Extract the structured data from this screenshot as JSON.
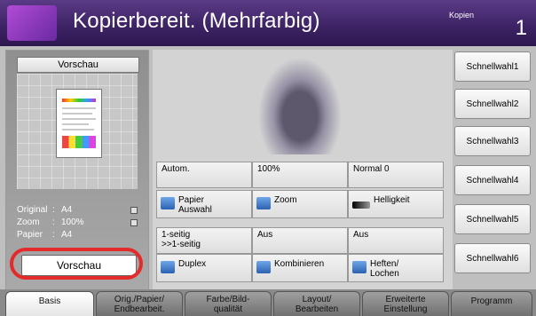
{
  "header": {
    "title": "Kopierbereit. (Mehrfarbig)",
    "copies_label": "Kopien",
    "copies_value": "1"
  },
  "left_panel": {
    "preview_header": "Vorschau",
    "info": [
      {
        "label": "Original",
        "value": "A4"
      },
      {
        "label": "Zoom",
        "value": "100%"
      },
      {
        "label": "Papier",
        "value": "A4"
      }
    ],
    "preview_button": "Vorschau"
  },
  "settings": {
    "values_row1": [
      "Autom.",
      "100%",
      "Normal 0"
    ],
    "buttons_row1": [
      {
        "label": "Papier\nAuswahl",
        "icon": "paper-icon"
      },
      {
        "label": "Zoom",
        "icon": "zoom-icon"
      },
      {
        "label": "Helligkeit",
        "icon": "density-icon"
      }
    ],
    "values_row2": [
      "1-seitig\n>>1-seitig",
      "Aus",
      "Aus"
    ],
    "buttons_row2": [
      {
        "label": "Duplex",
        "icon": "duplex-icon"
      },
      {
        "label": "Kombinieren",
        "icon": "combine-icon"
      },
      {
        "label": "Heften/\nLochen",
        "icon": "staple-icon"
      }
    ]
  },
  "quick_buttons": [
    "Schnellwahl1",
    "Schnellwahl2",
    "Schnellwahl3",
    "Schnellwahl4",
    "Schnellwahl5",
    "Schnellwahl6"
  ],
  "tabs": [
    {
      "label": "Basis",
      "active": true
    },
    {
      "label": "Orig./Papier/\nEndbearbeit."
    },
    {
      "label": "Farbe/Bild-\nqualität"
    },
    {
      "label": "Layout/\nBearbeiten"
    },
    {
      "label": "Erweiterte\nEinstellung"
    },
    {
      "label": "Programm"
    }
  ],
  "colors": {
    "header": "#3e2466",
    "highlight": "#e32b2b"
  }
}
